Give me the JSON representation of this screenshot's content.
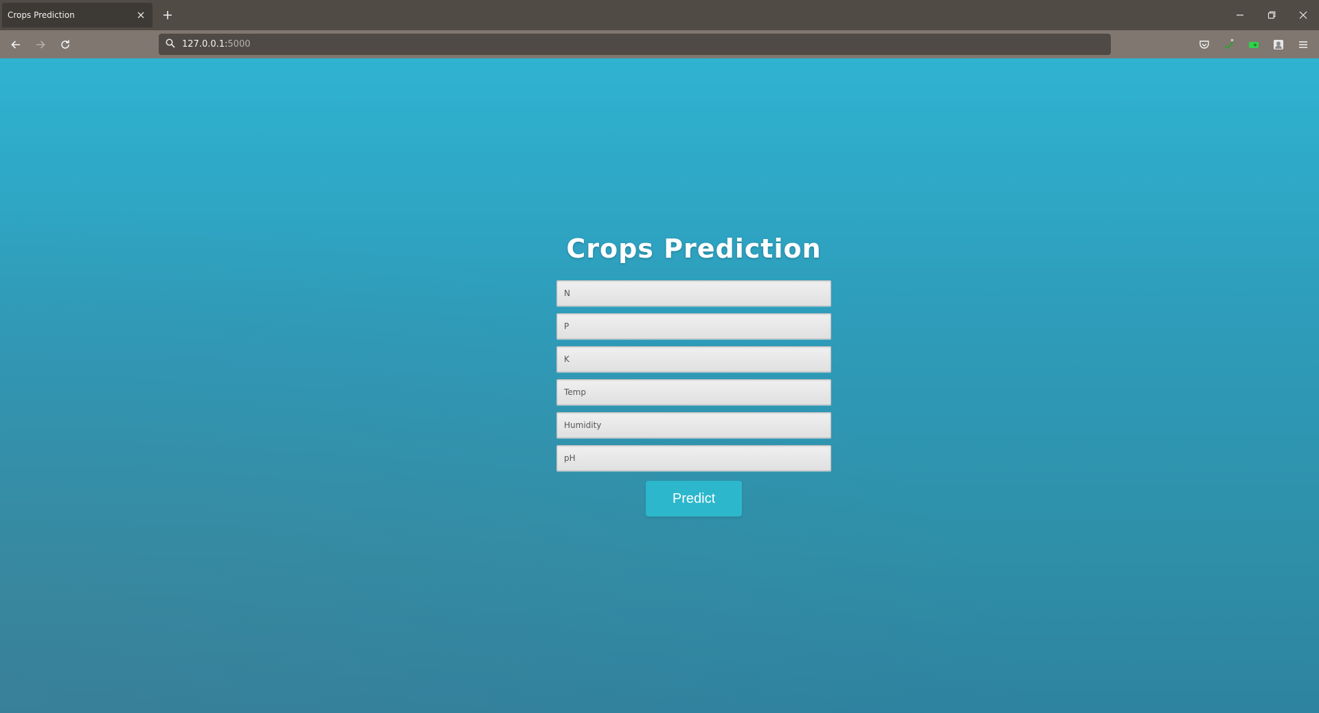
{
  "browser": {
    "tab": {
      "title": "Crops Prediction"
    },
    "url": {
      "host": "127.0.0.1:",
      "port": "5000"
    }
  },
  "colors": {
    "background_top": "#2fb3d1",
    "background_bottom": "#2d83a0",
    "button": "#2cb7cc"
  },
  "page": {
    "title": "Crops Prediction",
    "fields": [
      {
        "placeholder": "N",
        "value": ""
      },
      {
        "placeholder": "P",
        "value": ""
      },
      {
        "placeholder": "K",
        "value": ""
      },
      {
        "placeholder": "Temp",
        "value": ""
      },
      {
        "placeholder": "Humidity",
        "value": ""
      },
      {
        "placeholder": "pH",
        "value": ""
      }
    ],
    "submit_label": "Predict"
  }
}
